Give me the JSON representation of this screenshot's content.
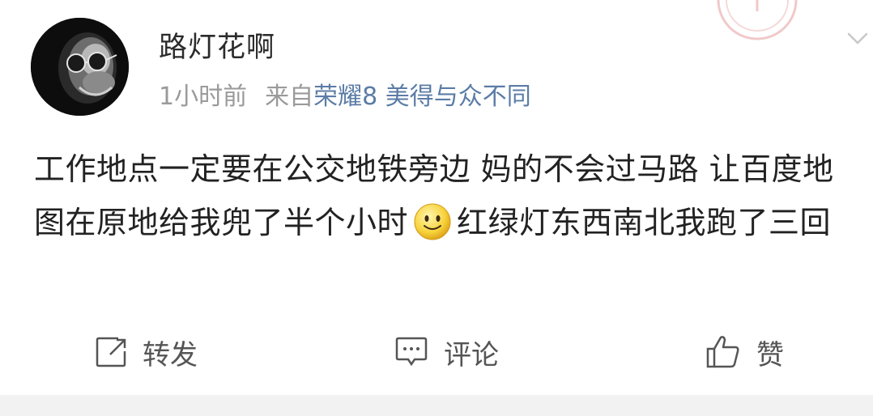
{
  "post": {
    "username": "路灯花啊",
    "time": "1小时前",
    "from_label": "来自",
    "device": "荣耀8 美得与众不同",
    "content_part1": "工作地点一定要在公交地铁旁边 妈的不会过马路 让百度地图在原地给我兜了半个小时",
    "content_part2": "红绿灯东西南北我跑了三回"
  },
  "actions": {
    "repost": "转发",
    "comment": "评论",
    "like": "赞"
  },
  "colors": {
    "device_link": "#5b7ca6",
    "meta_gray": "#9a9a9a",
    "footer_bg": "#f2f2f2"
  },
  "icons": [
    "repost-icon",
    "comment-icon",
    "like-icon",
    "chevron-down-icon",
    "smile-emoji-icon"
  ]
}
